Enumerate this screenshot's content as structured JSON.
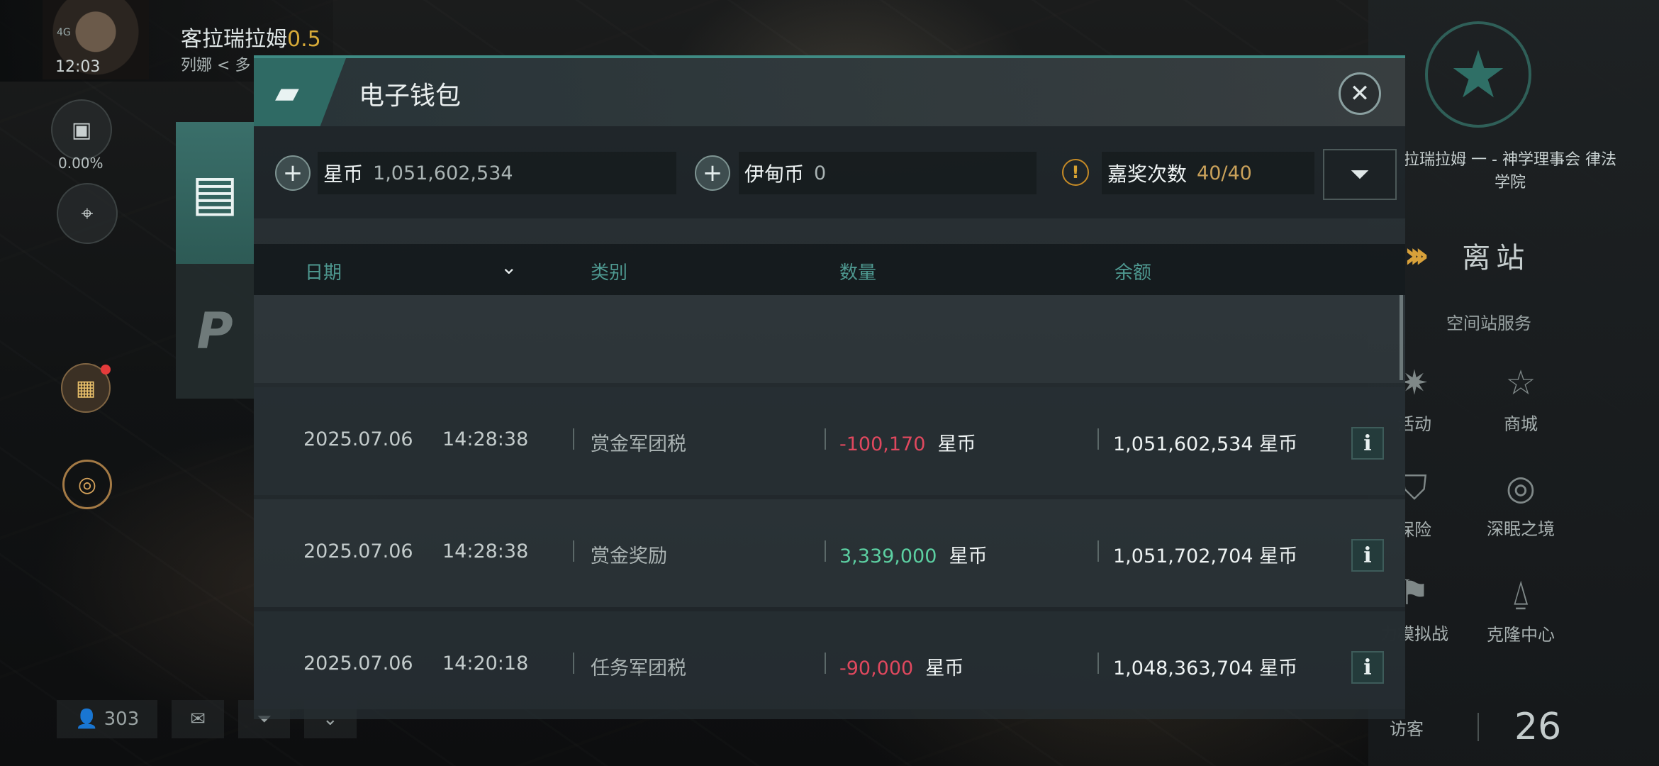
{
  "hud": {
    "signal": "4G",
    "clock": "12:03",
    "player_name": "客拉瑞拉姆",
    "security": "0.5",
    "location": "列娜 < 多",
    "percent": "0.00%"
  },
  "bottom_bar": {
    "count": "303"
  },
  "station": {
    "name": "拉瑞拉姆 一 - 神学理事会 律法学院",
    "undock": "离站",
    "services_title": "空间站服务",
    "services": [
      {
        "label": "活动",
        "icon": "party-icon"
      },
      {
        "label": "商城",
        "icon": "shop-icon"
      },
      {
        "label": "保险",
        "icon": "insurance-icon"
      },
      {
        "label": "深眠之境",
        "icon": "deep-sleep-icon"
      },
      {
        "label": "力模拟战",
        "icon": "simulation-icon"
      },
      {
        "label": "克隆中心",
        "icon": "clone-icon"
      }
    ],
    "visitors_label": "访客",
    "visitors_count": "26"
  },
  "wallet": {
    "title": "电子钱包",
    "currencies": [
      {
        "name": "星币",
        "value": "1,051,602,534"
      },
      {
        "name": "伊甸币",
        "value": "0"
      }
    ],
    "bounty": {
      "label": "嘉奖次数",
      "value": "40/40"
    },
    "columns": [
      "日期",
      "类别",
      "数量",
      "余额"
    ],
    "rows": [
      {
        "date": "2025.07.06",
        "time": "14:28:38",
        "category": "赏金军团税",
        "amount": "-100,170",
        "unit": "星币",
        "balance": "1,051,602,534 星币",
        "sign": "neg"
      },
      {
        "date": "2025.07.06",
        "time": "14:28:38",
        "category": "赏金奖励",
        "amount": "3,339,000",
        "unit": "星币",
        "balance": "1,051,702,704 星币",
        "sign": "pos"
      },
      {
        "date": "2025.07.06",
        "time": "14:20:18",
        "category": "任务军团税",
        "amount": "-90,000",
        "unit": "星币",
        "balance": "1,048,363,704 星币",
        "sign": "neg"
      }
    ]
  },
  "colors": {
    "accent": "#3f8b84",
    "negative": "#e0485e",
    "positive": "#5cd0a2",
    "gold": "#d6a938"
  }
}
